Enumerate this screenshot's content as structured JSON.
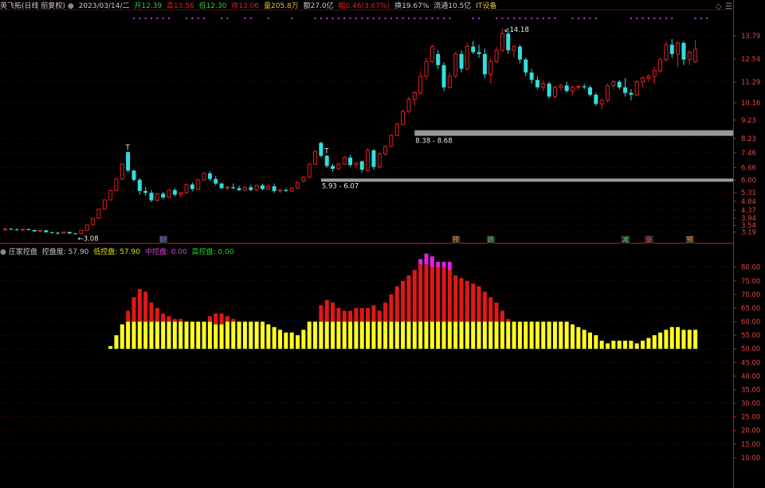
{
  "header": {
    "stock_name": "英飞拓(日线 前复权)",
    "date": "2023/03/14/二",
    "open_label": "开12.39",
    "high_label": "高13.56",
    "low_label": "低12.30",
    "close_label": "收13.06",
    "volume_label": "量205.8万",
    "amount_label": "额27.0亿",
    "change_label": "幅0.46(3.67%)",
    "turnover_label": "换19.67%",
    "float_label": "流通10.5亿",
    "sector_label": "IT设备",
    "colors": {
      "up": "#e02020",
      "down": "#33dddd",
      "gold": "#e0c040",
      "green": "#33cc33"
    }
  },
  "indicator_header": {
    "name": "庄家控盘",
    "control_label": "控盘度: 57.90",
    "low_label": "低控盘: 57.90",
    "mid_label": "中控盘: 0.00",
    "high_label": "高控盘: 0.00"
  },
  "chart_data": [
    {
      "type": "candlestick",
      "title": "英飞拓(日线 前复权)",
      "y_ticks": [
        "13.79",
        "12.54",
        "11.29",
        "10.16",
        "9.23",
        "8.23",
        "7.46",
        "6.66",
        "6.00",
        "5.31",
        "4.84",
        "4.37",
        "3.94",
        "3.54",
        "3.19"
      ],
      "ylim": [
        2.9,
        14.6
      ],
      "candles": [
        [
          3.3,
          3.4,
          3.25,
          3.35
        ],
        [
          3.35,
          3.4,
          3.3,
          3.32
        ],
        [
          3.32,
          3.38,
          3.28,
          3.3
        ],
        [
          3.3,
          3.35,
          3.25,
          3.33
        ],
        [
          3.33,
          3.38,
          3.27,
          3.29
        ],
        [
          3.29,
          3.32,
          3.2,
          3.22
        ],
        [
          3.22,
          3.3,
          3.18,
          3.27
        ],
        [
          3.27,
          3.3,
          3.15,
          3.17
        ],
        [
          3.17,
          3.2,
          3.1,
          3.14
        ],
        [
          3.14,
          3.18,
          3.05,
          3.12
        ],
        [
          3.12,
          3.2,
          3.1,
          3.18
        ],
        [
          3.18,
          3.2,
          3.08,
          3.1
        ],
        [
          3.1,
          3.14,
          3.06,
          3.08
        ],
        [
          3.08,
          3.3,
          3.08,
          3.28
        ],
        [
          3.28,
          3.6,
          3.25,
          3.58
        ],
        [
          3.58,
          3.95,
          3.55,
          3.93
        ],
        [
          3.93,
          4.45,
          3.9,
          4.42
        ],
        [
          4.42,
          4.95,
          4.4,
          4.92
        ],
        [
          4.92,
          5.45,
          4.9,
          5.42
        ],
        [
          5.42,
          6.1,
          5.4,
          6.05
        ],
        [
          6.05,
          6.9,
          6.0,
          6.85
        ],
        [
          7.5,
          7.55,
          6.4,
          6.5
        ],
        [
          6.5,
          6.55,
          5.9,
          6.0
        ],
        [
          6.0,
          6.1,
          5.2,
          5.4
        ],
        [
          5.4,
          5.6,
          5.15,
          5.3
        ],
        [
          5.3,
          5.45,
          4.8,
          4.9
        ],
        [
          4.9,
          5.3,
          4.85,
          5.25
        ],
        [
          5.25,
          5.35,
          4.95,
          5.05
        ],
        [
          5.05,
          5.5,
          5.0,
          5.45
        ],
        [
          5.45,
          5.55,
          5.1,
          5.2
        ],
        [
          5.2,
          5.35,
          5.05,
          5.3
        ],
        [
          5.3,
          5.8,
          5.25,
          5.75
        ],
        [
          5.75,
          5.85,
          5.4,
          5.5
        ],
        [
          5.5,
          6.05,
          5.45,
          6.0
        ],
        [
          6.0,
          6.4,
          5.95,
          6.35
        ],
        [
          6.35,
          6.45,
          5.95,
          6.05
        ],
        [
          6.05,
          6.2,
          5.7,
          5.8
        ],
        [
          5.8,
          5.85,
          5.5,
          5.55
        ],
        [
          5.55,
          5.7,
          5.45,
          5.6
        ],
        [
          5.6,
          5.8,
          5.5,
          5.55
        ],
        [
          5.55,
          5.7,
          5.4,
          5.45
        ],
        [
          5.45,
          5.65,
          5.4,
          5.6
        ],
        [
          5.6,
          5.75,
          5.4,
          5.45
        ],
        [
          5.45,
          5.75,
          5.4,
          5.7
        ],
        [
          5.7,
          5.8,
          5.45,
          5.5
        ],
        [
          5.5,
          5.75,
          5.45,
          5.65
        ],
        [
          5.65,
          5.8,
          5.3,
          5.4
        ],
        [
          5.4,
          5.5,
          5.3,
          5.45
        ],
        [
          5.45,
          5.55,
          5.35,
          5.4
        ],
        [
          5.4,
          5.6,
          5.35,
          5.55
        ],
        [
          5.55,
          5.9,
          5.5,
          5.85
        ],
        [
          5.93,
          6.2,
          5.85,
          6.15
        ],
        [
          6.15,
          6.9,
          6.1,
          6.85
        ],
        [
          6.85,
          7.6,
          6.8,
          7.55
        ],
        [
          8.0,
          8.05,
          7.2,
          7.3
        ],
        [
          7.3,
          7.35,
          6.65,
          6.75
        ],
        [
          6.75,
          6.85,
          6.45,
          6.6
        ],
        [
          6.6,
          6.95,
          6.55,
          6.85
        ],
        [
          6.85,
          7.3,
          6.8,
          7.2
        ],
        [
          7.2,
          7.35,
          6.7,
          6.8
        ],
        [
          6.8,
          7.0,
          6.6,
          6.9
        ],
        [
          7.0,
          7.05,
          6.4,
          6.55
        ],
        [
          6.5,
          7.7,
          6.45,
          7.6
        ],
        [
          7.6,
          7.65,
          6.55,
          6.7
        ],
        [
          6.7,
          7.5,
          6.6,
          7.4
        ],
        [
          7.4,
          7.9,
          7.3,
          7.8
        ],
        [
          7.8,
          8.45,
          7.75,
          8.4
        ],
        [
          8.4,
          9.1,
          8.35,
          9.0
        ],
        [
          9.0,
          9.8,
          8.95,
          9.7
        ],
        [
          9.7,
          10.5,
          9.6,
          10.35
        ],
        [
          10.35,
          10.8,
          10.0,
          10.7
        ],
        [
          10.7,
          11.8,
          10.6,
          11.6
        ],
        [
          11.6,
          12.6,
          11.4,
          12.4
        ],
        [
          12.4,
          13.3,
          12.3,
          13.2
        ],
        [
          12.8,
          13.0,
          12.0,
          12.2
        ],
        [
          12.2,
          12.35,
          10.8,
          11.0
        ],
        [
          11.0,
          11.8,
          10.9,
          11.6
        ],
        [
          11.6,
          12.9,
          11.5,
          12.8
        ],
        [
          12.8,
          13.0,
          11.8,
          12.0
        ],
        [
          12.0,
          13.4,
          11.9,
          13.2
        ],
        [
          13.2,
          13.5,
          12.8,
          12.9
        ],
        [
          12.9,
          13.3,
          12.6,
          12.8
        ],
        [
          12.8,
          13.1,
          11.5,
          11.7
        ],
        [
          11.7,
          12.6,
          11.2,
          12.4
        ],
        [
          12.4,
          13.2,
          12.3,
          13.0
        ],
        [
          13.0,
          14.18,
          12.9,
          13.9
        ],
        [
          13.9,
          14.1,
          12.8,
          13.0
        ],
        [
          13.0,
          13.3,
          12.6,
          13.2
        ],
        [
          13.2,
          13.3,
          12.3,
          12.5
        ],
        [
          12.5,
          12.6,
          11.6,
          11.8
        ],
        [
          11.8,
          12.0,
          11.2,
          11.4
        ],
        [
          11.4,
          11.6,
          10.9,
          11.0
        ],
        [
          11.0,
          11.4,
          10.8,
          11.2
        ],
        [
          11.2,
          11.3,
          10.4,
          10.5
        ],
        [
          10.5,
          11.1,
          10.4,
          11.0
        ],
        [
          11.0,
          11.2,
          10.8,
          11.1
        ],
        [
          11.1,
          11.3,
          10.7,
          10.8
        ],
        [
          10.8,
          11.1,
          10.6,
          11.0
        ],
        [
          11.0,
          11.15,
          10.85,
          11.05
        ],
        [
          11.05,
          11.2,
          10.9,
          11.0
        ],
        [
          11.0,
          11.1,
          10.5,
          10.6
        ],
        [
          10.6,
          10.7,
          10.0,
          10.1
        ],
        [
          10.1,
          10.4,
          9.8,
          10.3
        ],
        [
          10.3,
          11.2,
          10.2,
          11.1
        ],
        [
          11.1,
          11.4,
          10.9,
          11.3
        ],
        [
          11.3,
          11.4,
          10.9,
          11.0
        ],
        [
          11.0,
          11.5,
          10.5,
          10.7
        ],
        [
          10.7,
          10.9,
          10.3,
          10.6
        ],
        [
          10.6,
          11.4,
          10.5,
          11.3
        ],
        [
          11.3,
          11.6,
          11.0,
          11.5
        ],
        [
          11.5,
          11.7,
          11.3,
          11.6
        ],
        [
          11.6,
          12.1,
          11.2,
          11.9
        ],
        [
          11.9,
          12.6,
          11.8,
          12.5
        ],
        [
          12.5,
          13.5,
          12.4,
          13.3
        ],
        [
          13.3,
          13.6,
          12.6,
          12.8
        ],
        [
          12.8,
          13.5,
          12.1,
          13.4
        ],
        [
          13.4,
          13.5,
          12.2,
          12.5
        ],
        [
          12.5,
          13.0,
          12.2,
          12.9
        ],
        [
          12.39,
          13.56,
          12.3,
          13.06
        ]
      ],
      "annotations": [
        {
          "text": "3.08",
          "kind": "low"
        },
        {
          "text": "14.18",
          "kind": "high"
        },
        {
          "text": "5.93 - 6.07",
          "kind": "zone"
        },
        {
          "text": "8.38 - 8.68",
          "kind": "zone"
        }
      ],
      "zones": [
        [
          5.93,
          6.07
        ],
        [
          8.38,
          8.68
        ]
      ],
      "event_markers": [
        {
          "text": "财",
          "color": "#6b8cff"
        },
        {
          "text": "预",
          "color": "#ff8c3a"
        },
        {
          "text": "跌",
          "color": "#5fd35f"
        },
        {
          "text": "减",
          "color": "#5fd35f"
        },
        {
          "text": "涨",
          "color": "#ff4040"
        },
        {
          "text": "预",
          "color": "#ff8c3a"
        }
      ],
      "marker_glyph": "T",
      "menu_glyphs": [
        "◇",
        "☰"
      ]
    },
    {
      "type": "bar",
      "title": "庄家控盘",
      "y_ticks": [
        "80.00",
        "75.00",
        "70.00",
        "65.00",
        "60.00",
        "55.00",
        "50.00",
        "45.00",
        "40.00",
        "35.00",
        "30.00",
        "25.00",
        "20.00",
        "15.00",
        "10.00"
      ],
      "ylim": [
        5,
        84
      ],
      "base": 50,
      "low_control": [
        51,
        55,
        59,
        60,
        60,
        60,
        60,
        60,
        60,
        60,
        60,
        60,
        60,
        60,
        60,
        60,
        60,
        60,
        59,
        59,
        60,
        60,
        60,
        60,
        60,
        60,
        60,
        59,
        58,
        57,
        56,
        56,
        55,
        57,
        60,
        60,
        60,
        60,
        60,
        60,
        60,
        60,
        60,
        60,
        60,
        60,
        60,
        60,
        60,
        60,
        60,
        60,
        60,
        60,
        60,
        60,
        60,
        60,
        60,
        60,
        60,
        60,
        60,
        60,
        60,
        60,
        60,
        60,
        60,
        60,
        60,
        60,
        60,
        60,
        60,
        60,
        60,
        60,
        60,
        59,
        58,
        57,
        56,
        55,
        53,
        52,
        53,
        53,
        53,
        53,
        52,
        53,
        54,
        55,
        56,
        57,
        58,
        58,
        57,
        57,
        57,
        58
      ],
      "mid_control": [
        0,
        0,
        0,
        64,
        69,
        72,
        71,
        67,
        65,
        63,
        62,
        61,
        61,
        60,
        59,
        59,
        60,
        62,
        63,
        63,
        62,
        61,
        60,
        60,
        59,
        0,
        0,
        0,
        0,
        0,
        0,
        0,
        0,
        0,
        0,
        0,
        66,
        68,
        67,
        65,
        64,
        64,
        65,
        65,
        65,
        66,
        64,
        67,
        70,
        73,
        75,
        77,
        79,
        81,
        81,
        80,
        80,
        80,
        79,
        77,
        76,
        75,
        74,
        73,
        71,
        69,
        67,
        64,
        61,
        60,
        0,
        0,
        0,
        0,
        0,
        0,
        0,
        0,
        0,
        0,
        0,
        0,
        0,
        0,
        0,
        0,
        0,
        0,
        0,
        0,
        0,
        0,
        0,
        0,
        0,
        0,
        0,
        0,
        0,
        0,
        0,
        0
      ],
      "high_control": [
        0,
        0,
        0,
        0,
        0,
        0,
        0,
        0,
        0,
        0,
        0,
        0,
        0,
        0,
        0,
        0,
        0,
        0,
        0,
        0,
        0,
        0,
        0,
        0,
        0,
        0,
        0,
        0,
        0,
        0,
        0,
        0,
        0,
        0,
        0,
        0,
        0,
        0,
        0,
        0,
        0,
        0,
        0,
        0,
        0,
        0,
        0,
        0,
        0,
        0,
        0,
        0,
        0,
        83,
        85,
        84,
        82,
        82,
        82,
        0,
        0,
        0,
        0,
        0,
        0,
        0,
        0,
        0,
        0,
        0,
        0,
        0,
        0,
        0,
        0,
        0,
        0,
        0,
        0,
        0,
        0,
        0,
        0,
        0,
        0,
        0,
        0,
        0,
        0,
        0,
        0,
        0,
        0,
        0,
        0,
        0,
        0,
        0,
        0,
        0,
        0,
        0
      ]
    }
  ]
}
